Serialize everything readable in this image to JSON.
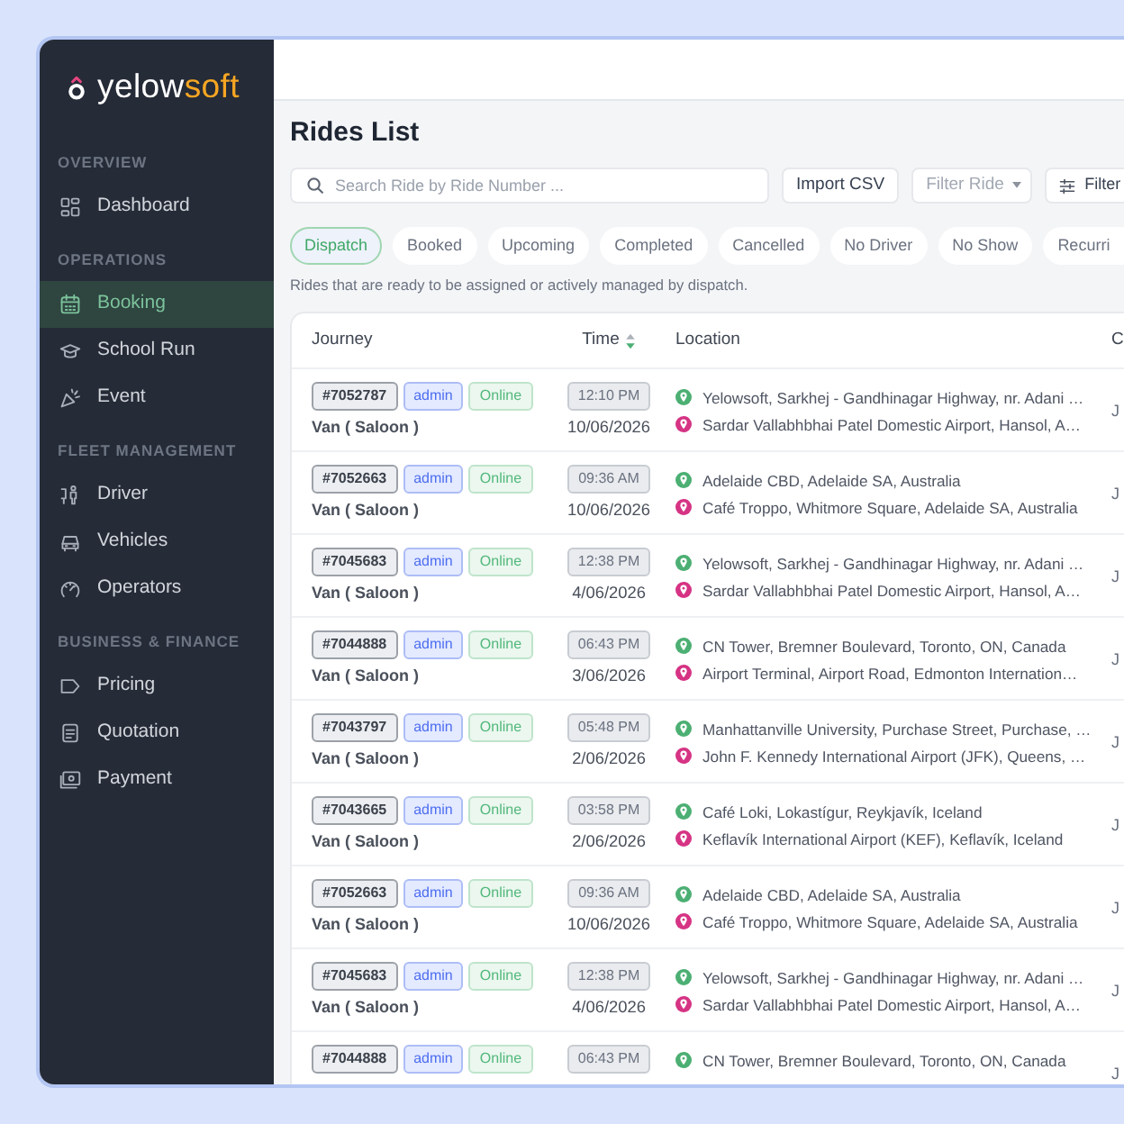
{
  "sidebar": {
    "logo": {
      "parts": [
        {
          "text": "yelow",
          "color": "#ffffff"
        },
        {
          "text": "soft",
          "color": "#f6a623"
        }
      ]
    },
    "sections": [
      {
        "heading": "OVERVIEW",
        "items": [
          {
            "label": "Dashboard",
            "selected": false
          }
        ]
      },
      {
        "heading": "OPERATIONS",
        "items": [
          {
            "label": "Booking",
            "selected": true
          },
          {
            "label": "School Run",
            "selected": false
          },
          {
            "label": "Event",
            "selected": false
          }
        ]
      },
      {
        "heading": "FLEET MANAGEMENT",
        "items": [
          {
            "label": "Driver",
            "selected": false
          },
          {
            "label": "Vehicles",
            "selected": false
          },
          {
            "label": "Operators",
            "selected": false
          }
        ]
      },
      {
        "heading": "BUSINESS & FINANCE",
        "items": [
          {
            "label": "Pricing",
            "selected": false
          },
          {
            "label": "Quotation",
            "selected": false
          },
          {
            "label": "Payment",
            "selected": false
          }
        ]
      }
    ]
  },
  "page": {
    "title": "Rides List"
  },
  "toolbar": {
    "search": {
      "placeholder": "Search Ride by Ride Number ..."
    },
    "import_button": "Import CSV",
    "filter_dropdown": {
      "placeholder": "Filter Ride"
    },
    "filter_button": "Filter"
  },
  "status_tabs": [
    {
      "label": "Dispatch",
      "selected": true
    },
    {
      "label": "Booked",
      "selected": false
    },
    {
      "label": "Upcoming",
      "selected": false
    },
    {
      "label": "Completed",
      "selected": false
    },
    {
      "label": "Cancelled",
      "selected": false
    },
    {
      "label": "No Driver",
      "selected": false
    },
    {
      "label": "No Show",
      "selected": false
    },
    {
      "label": "Recurri",
      "selected": false
    }
  ],
  "status_description": "Rides that are ready to be assigned or actively managed by dispatch.",
  "table": {
    "columns": [
      {
        "label": "Journey"
      },
      {
        "label": "Time",
        "sortable": true,
        "sort_descending": true
      },
      {
        "label": "Location"
      },
      {
        "label": "C"
      }
    ],
    "rows": [
      {
        "ride_number": "#7052787",
        "created_by": "admin",
        "source": "Online",
        "vehicle": "Van ( Saloon )",
        "time": "12:10 PM",
        "date": "10/06/2026",
        "pickup": "Yelowsoft, Sarkhej - Gandhinagar Highway, nr. Adani …",
        "dropoff": "Sardar Vallabhbhai Patel Domestic Airport, Hansol, A…",
        "column_4": "J"
      },
      {
        "ride_number": "#7052663",
        "created_by": "admin",
        "source": "Online",
        "vehicle": "Van ( Saloon )",
        "time": "09:36 AM",
        "date": "10/06/2026",
        "pickup": "Adelaide CBD, Adelaide SA, Australia",
        "dropoff": "Café Troppo, Whitmore Square, Adelaide SA, Australia",
        "column_4": "J"
      },
      {
        "ride_number": "#7045683",
        "created_by": "admin",
        "source": "Online",
        "vehicle": "Van ( Saloon )",
        "time": "12:38 PM",
        "date": "4/06/2026",
        "pickup": "Yelowsoft, Sarkhej - Gandhinagar Highway, nr. Adani …",
        "dropoff": "Sardar Vallabhbhai Patel Domestic Airport, Hansol, A…",
        "column_4": "J"
      },
      {
        "ride_number": "#7044888",
        "created_by": "admin",
        "source": "Online",
        "vehicle": "Van ( Saloon )",
        "time": "06:43 PM",
        "date": "3/06/2026",
        "pickup": "CN Tower, Bremner Boulevard, Toronto, ON, Canada",
        "dropoff": "Airport Terminal, Airport Road, Edmonton Internation…",
        "column_4": "J"
      },
      {
        "ride_number": "#7043797",
        "created_by": "admin",
        "source": "Online",
        "vehicle": "Van ( Saloon )",
        "time": "05:48 PM",
        "date": "2/06/2026",
        "pickup": "Manhattanville University, Purchase Street, Purchase, …",
        "dropoff": "John F. Kennedy International Airport (JFK), Queens, …",
        "column_4": "J"
      },
      {
        "ride_number": "#7043665",
        "created_by": "admin",
        "source": "Online",
        "vehicle": "Van ( Saloon )",
        "time": "03:58 PM",
        "date": "2/06/2026",
        "pickup": "Café Loki, Lokastígur, Reykjavík, Iceland",
        "dropoff": "Keflavík International Airport (KEF), Keflavík, Iceland",
        "column_4": "J"
      },
      {
        "ride_number": "#7052663",
        "created_by": "admin",
        "source": "Online",
        "vehicle": "Van ( Saloon )",
        "time": "09:36 AM",
        "date": "10/06/2026",
        "pickup": "Adelaide CBD, Adelaide SA, Australia",
        "dropoff": "Café Troppo, Whitmore Square, Adelaide SA, Australia",
        "column_4": "J"
      },
      {
        "ride_number": "#7045683",
        "created_by": "admin",
        "source": "Online",
        "vehicle": "Van ( Saloon )",
        "time": "12:38 PM",
        "date": "4/06/2026",
        "pickup": "Yelowsoft, Sarkhej - Gandhinagar Highway, nr. Adani …",
        "dropoff": "Sardar Vallabhbhai Patel Domestic Airport, Hansol, A…",
        "column_4": "J"
      },
      {
        "ride_number": "#7044888",
        "created_by": "admin",
        "source": "Online",
        "time": "06:43 PM",
        "pickup": "CN Tower, Bremner Boulevard, Toronto, ON, Canada",
        "column_4": "J"
      }
    ]
  }
}
